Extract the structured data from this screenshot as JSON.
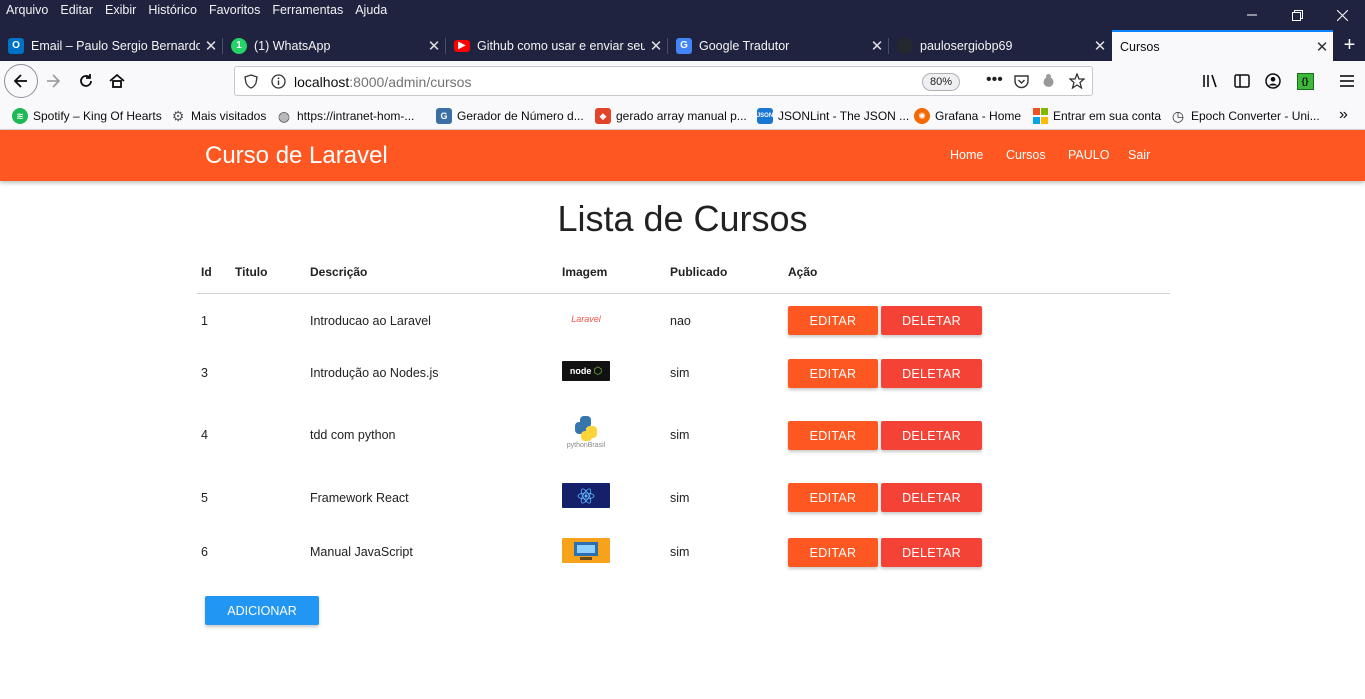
{
  "browser": {
    "menu": [
      "Arquivo",
      "Editar",
      "Exibir",
      "Histórico",
      "Favoritos",
      "Ferramentas",
      "Ajuda"
    ],
    "window_controls": {
      "minimize": "—",
      "restore": "❐",
      "close": "✕"
    },
    "tabs": [
      {
        "title": "Email – Paulo Sergio Bernardo",
        "icon": "outlook-icon",
        "color": "#0072c6"
      },
      {
        "title": "(1) WhatsApp",
        "icon": "whatsapp-icon",
        "color": "#25d366"
      },
      {
        "title": "Github como usar e enviar seu",
        "icon": "youtube-icon",
        "color": "#ff0000"
      },
      {
        "title": "Google Tradutor",
        "icon": "google-translate-icon",
        "color": "#4285f4"
      },
      {
        "title": "paulosergiobp69",
        "icon": "github-icon",
        "color": "#24292e"
      },
      {
        "title": "Cursos",
        "icon": "none",
        "color": "#f9f9fb"
      }
    ],
    "url": {
      "host": "localhost",
      "rest": ":8000/admin/cursos"
    },
    "zoom": "80%",
    "bookmarks": [
      {
        "label": "Spotify – King Of Hearts",
        "icon": "spotify-icon",
        "color": "#1db954"
      },
      {
        "label": "Mais visitados",
        "icon": "gear-icon",
        "color": "#555555"
      },
      {
        "label": "https://intranet-hom-...",
        "icon": "globe-icon",
        "color": "#555555"
      },
      {
        "label": "Gerador de Número d...",
        "icon": "generator-icon",
        "color": "#3b6ea5"
      },
      {
        "label": "gerado array manual p...",
        "icon": "gitlab-icon",
        "color": "#e24329"
      },
      {
        "label": "JSONLint - The JSON ...",
        "icon": "jsonlint-icon",
        "color": "#1976d2"
      },
      {
        "label": "Grafana - Home",
        "icon": "grafana-icon",
        "color": "#f46800"
      },
      {
        "label": "Entrar em sua conta",
        "icon": "microsoft-icon",
        "color": "#f25022"
      },
      {
        "label": "Epoch Converter - Uni...",
        "icon": "clock-icon",
        "color": "#333333"
      }
    ]
  },
  "app": {
    "brand": "Curso de Laravel",
    "nav": [
      "Home",
      "Cursos",
      "PAULO",
      "Sair"
    ],
    "accent": "#ff5722"
  },
  "page": {
    "title": "Lista de Cursos",
    "columns": [
      "Id",
      "Titulo",
      "Descrição",
      "Imagem",
      "Publicado",
      "Ação"
    ],
    "rows": [
      {
        "id": "1",
        "titulo": "",
        "descricao": "Introducao ao Laravel",
        "imagem": "laravel-logo",
        "publicado": "nao"
      },
      {
        "id": "3",
        "titulo": "",
        "descricao": "Introdução ao Nodes.js",
        "imagem": "nodejs-logo",
        "publicado": "sim"
      },
      {
        "id": "4",
        "titulo": "",
        "descricao": "tdd com python",
        "imagem": "python-logo",
        "publicado": "sim"
      },
      {
        "id": "5",
        "titulo": "",
        "descricao": "Framework React",
        "imagem": "react-logo",
        "publicado": "sim"
      },
      {
        "id": "6",
        "titulo": "",
        "descricao": "Manual JavaScript",
        "imagem": "javascript-image",
        "publicado": "sim"
      }
    ],
    "edit_label": "EDITAR",
    "delete_label": "DELETAR",
    "add_label": "ADICIONAR",
    "colors": {
      "edit": "#ff5722",
      "delete": "#f44336",
      "add": "#2196f3"
    }
  },
  "thumb_text": {
    "laravel": "Laravel",
    "node": "node",
    "python": "pythonBrasil"
  }
}
